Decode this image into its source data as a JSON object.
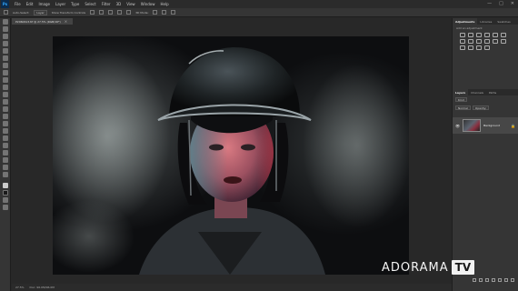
{
  "menu": {
    "logo": "Ps",
    "items": [
      "File",
      "Edit",
      "Image",
      "Layer",
      "Type",
      "Select",
      "Filter",
      "3D",
      "View",
      "Window",
      "Help"
    ]
  },
  "window_controls": [
    "—",
    "□",
    "✕"
  ],
  "options": {
    "tool_icon": "move-tool-icon",
    "auto_select_label": "Auto-Select:",
    "layer_value": "Layer",
    "transform_label": "Show Transform Controls",
    "mode_3d": "3D Mode:"
  },
  "document": {
    "tab_title": "P2060613.tif @ 27.5% (RGB/16*)",
    "close": "×"
  },
  "status": {
    "zoom": "27.5%",
    "doc_size": "Doc: 96.0M/96.0M"
  },
  "adjustments": {
    "tabs": [
      "Adjustments",
      "Libraries",
      "Swatches"
    ],
    "prompt": "Add an adjustment"
  },
  "layers": {
    "tabs": [
      "Layers",
      "Channels",
      "Paths"
    ],
    "kind_label": "Kind",
    "blend_mode": "Normal",
    "opacity_label": "Opacity:",
    "items": [
      {
        "name": "Background",
        "visible": true,
        "locked": true
      }
    ]
  },
  "watermark": {
    "brand": "ADORAMA",
    "suffix": "TV"
  },
  "colors": {
    "accent": "#31a8ff",
    "panel": "#353535",
    "canvas": "#282828"
  }
}
